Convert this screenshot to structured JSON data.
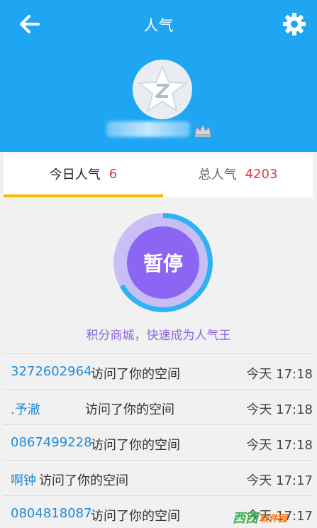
{
  "header": {
    "title": "人气",
    "back_icon": "arrow-left-icon",
    "settings_icon": "gear-icon",
    "background": "#1fa6f3"
  },
  "profile": {
    "avatar_icon": "qzone-star-icon",
    "badge_icon": "crown-icon"
  },
  "tabs": [
    {
      "label": "今日人气",
      "count": "6",
      "active": true
    },
    {
      "label": "总人气",
      "count": "4203",
      "active": false
    }
  ],
  "timer": {
    "button_label": "暂停",
    "progress": 0.67,
    "progress_color": "#2fb2f2",
    "button_color": "#8c66f2"
  },
  "promo_text": "积分商城，快速成为人气王",
  "visits": [
    {
      "visitor": "3272602964",
      "action": "访问了你的空间",
      "time": "今天 17:18"
    },
    {
      "visitor": ".予澈",
      "action": "访问了你的空间",
      "time": "今天 17:18"
    },
    {
      "visitor": "0867499228",
      "action": "访问了你的空间",
      "time": "今天 17:18"
    },
    {
      "visitor": "啊钟",
      "action": "访问了你的空间",
      "time": "今天 17:17"
    },
    {
      "visitor": "0804818087",
      "action": "访问了你的空间",
      "time": "今天 17:17"
    }
  ],
  "watermark": {
    "logo": "西西",
    "text": "软件园",
    "subtext": "CR173.COM"
  }
}
